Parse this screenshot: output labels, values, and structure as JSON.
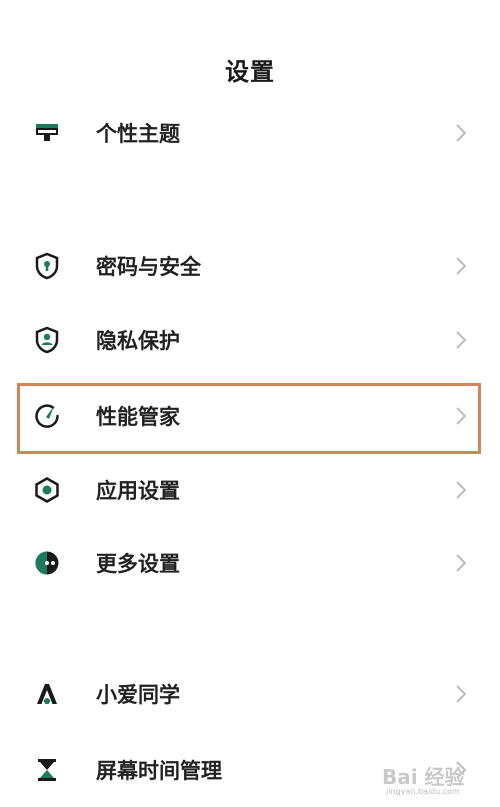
{
  "header": {
    "title": "设置"
  },
  "items": [
    {
      "id": "theme",
      "label": "个性主题",
      "icon": "theme-icon"
    },
    {
      "id": "security",
      "label": "密码与安全",
      "icon": "shield-lock-icon"
    },
    {
      "id": "privacy",
      "label": "隐私保护",
      "icon": "privacy-shield-icon"
    },
    {
      "id": "performance",
      "label": "性能管家",
      "icon": "performance-gauge-icon",
      "highlighted": true
    },
    {
      "id": "app-settings",
      "label": "应用设置",
      "icon": "hexagon-icon"
    },
    {
      "id": "more-settings",
      "label": "更多设置",
      "icon": "more-dots-icon"
    },
    {
      "id": "xiaoai",
      "label": "小爱同学",
      "icon": "xiaoai-icon"
    },
    {
      "id": "screen-time",
      "label": "屏幕时间管理",
      "icon": "hourglass-icon"
    }
  ],
  "colors": {
    "icon_green": "#1d7a5c",
    "icon_dark": "#1a1a1a",
    "highlight": "#d2855a",
    "chevron": "#bdbdbd"
  },
  "watermark": {
    "text": "Bai 经验",
    "sub": "jingyan.baidu.com"
  }
}
